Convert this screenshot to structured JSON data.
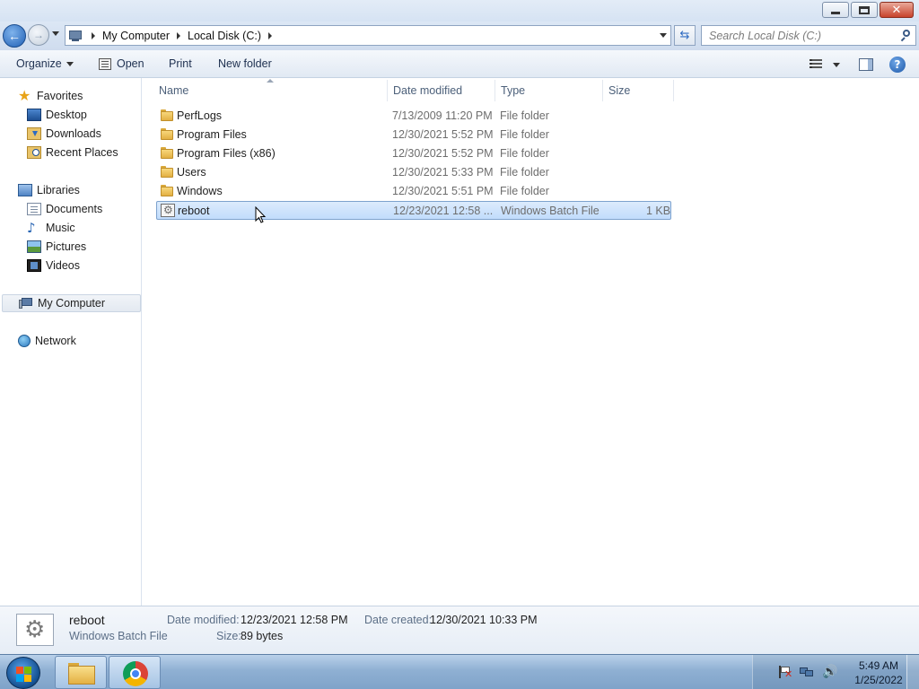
{
  "window": {
    "caption_buttons": {
      "minimize": "minimize",
      "maximize": "maximize",
      "close": "✕"
    }
  },
  "nav": {
    "breadcrumbs": [
      "My Computer",
      "Local Disk (C:)"
    ],
    "search_placeholder": "Search Local Disk (C:)",
    "refresh_glyph": "⇆"
  },
  "toolbar": {
    "organize": "Organize",
    "open": "Open",
    "print": "Print",
    "new_folder": "New folder",
    "help_glyph": "?"
  },
  "sidebar": {
    "favorites": "Favorites",
    "favorites_items": [
      "Desktop",
      "Downloads",
      "Recent Places"
    ],
    "libraries": "Libraries",
    "libraries_items": [
      "Documents",
      "Music",
      "Pictures",
      "Videos"
    ],
    "my_computer": "My Computer",
    "network": "Network",
    "icons": {
      "favorites": "star-icon",
      "desktop": "desktop-icon",
      "downloads": "downloads-icon",
      "recent": "recent-places-icon",
      "libraries": "libraries-icon",
      "documents": "documents-icon",
      "music": "music-icon",
      "pictures": "pictures-icon",
      "videos": "videos-icon",
      "my_computer": "computer-icon",
      "network": "network-icon"
    },
    "music_glyph": "♪",
    "star_glyph": "★"
  },
  "files": {
    "columns": [
      "Name",
      "Date modified",
      "Type",
      "Size"
    ],
    "rows": [
      {
        "name": "PerfLogs",
        "date": "7/13/2009 11:20 PM",
        "type": "File folder",
        "size": "",
        "icon": "folder-icon"
      },
      {
        "name": "Program Files",
        "date": "12/30/2021 5:52 PM",
        "type": "File folder",
        "size": "",
        "icon": "folder-icon"
      },
      {
        "name": "Program Files (x86)",
        "date": "12/30/2021 5:52 PM",
        "type": "File folder",
        "size": "",
        "icon": "folder-icon"
      },
      {
        "name": "Users",
        "date": "12/30/2021 5:33 PM",
        "type": "File folder",
        "size": "",
        "icon": "folder-icon"
      },
      {
        "name": "Windows",
        "date": "12/30/2021 5:51 PM",
        "type": "File folder",
        "size": "",
        "icon": "folder-icon"
      },
      {
        "name": "reboot",
        "date": "12/23/2021 12:58 ...",
        "type": "Windows Batch File",
        "size": "1 KB",
        "icon": "batch-file-icon",
        "selected": true
      }
    ]
  },
  "details": {
    "name": "reboot",
    "type": "Windows Batch File",
    "date_modified_label": "Date modified:",
    "date_modified": "12/23/2021 12:58 PM",
    "date_created_label": "Date created:",
    "date_created": "12/30/2021 10:33 PM",
    "size_label": "Size:",
    "size": "89 bytes"
  },
  "taskbar": {
    "apps": [
      "Windows Explorer",
      "Google Chrome"
    ],
    "time": "5:49 AM",
    "date": "1/25/2022",
    "volume_glyph": "🔊"
  },
  "colors": {
    "selection": "#c1dcfc",
    "selection_border": "#7da2ce",
    "accent": "#1d58a8"
  }
}
